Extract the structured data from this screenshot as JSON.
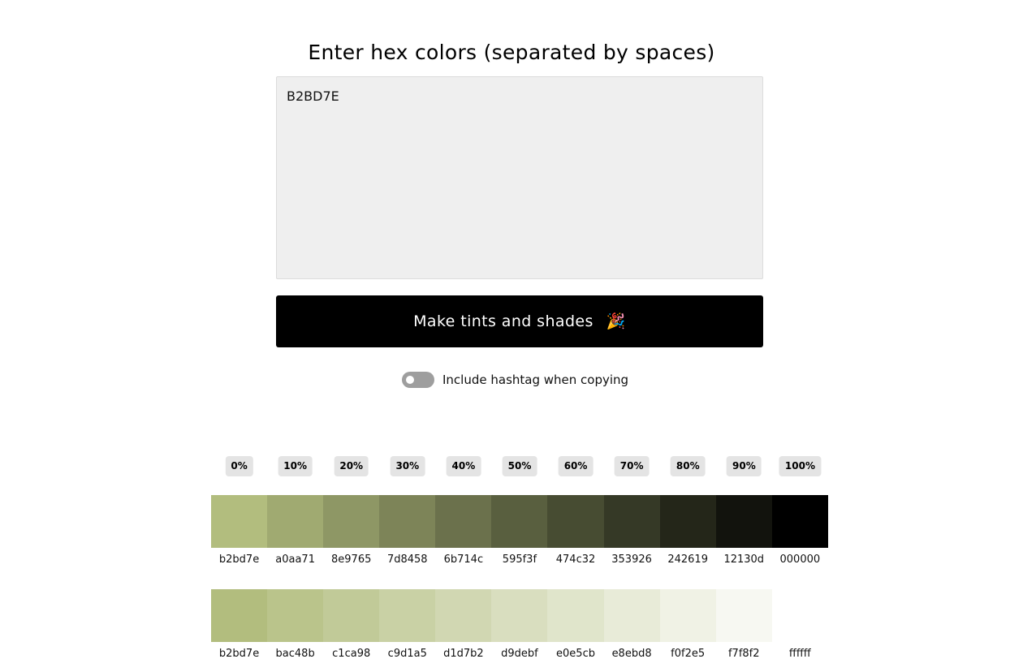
{
  "header": {
    "title": "Enter hex colors (separated by spaces)"
  },
  "input": {
    "value": "B2BD7E"
  },
  "actions": {
    "make_label": "Make tints and shades",
    "make_icon": "🎉",
    "make_icon_name": "party-popper-icon"
  },
  "options": {
    "hashtag_label": "Include hashtag when copying",
    "hashtag_enabled": false
  },
  "percentages": [
    "0%",
    "10%",
    "20%",
    "30%",
    "40%",
    "50%",
    "60%",
    "70%",
    "80%",
    "90%",
    "100%"
  ],
  "shades": [
    "b2bd7e",
    "a0aa71",
    "8e9765",
    "7d8458",
    "6b714c",
    "595f3f",
    "474c32",
    "353926",
    "242619",
    "12130d",
    "000000"
  ],
  "tints": [
    "b2bd7e",
    "bac48b",
    "c1ca98",
    "c9d1a5",
    "d1d7b2",
    "d9debf",
    "e0e5cb",
    "e8ebd8",
    "f0f2e5",
    "f7f8f2",
    "ffffff"
  ]
}
